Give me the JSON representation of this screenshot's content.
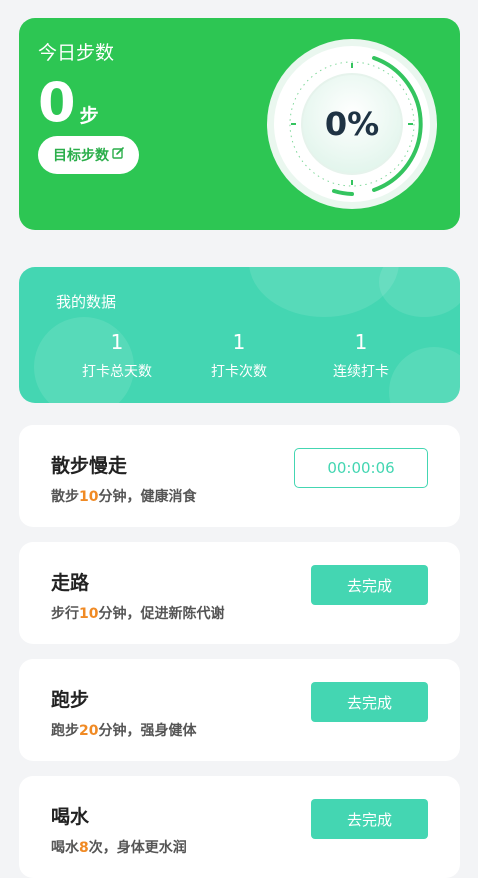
{
  "steps": {
    "title": "今日步数",
    "count": "0",
    "unit": "步",
    "goal_label": "目标步数",
    "percent": "0%",
    "percent_value": 0,
    "accent": "#2dc653"
  },
  "my_data": {
    "title": "我的数据",
    "stats": [
      {
        "value": "1",
        "label": "打卡总天数"
      },
      {
        "value": "1",
        "label": "打卡次数"
      },
      {
        "value": "1",
        "label": "连续打卡"
      }
    ],
    "color": "#44d6b2"
  },
  "tasks": [
    {
      "name": "散步慢走",
      "desc_prefix": "散步",
      "highlight": "10",
      "desc_suffix": "分钟，健康消食",
      "timer": "00:00:06"
    },
    {
      "name": "走路",
      "desc_prefix": "步行",
      "highlight": "10",
      "desc_suffix": "分钟，促进新陈代谢",
      "button": "去完成"
    },
    {
      "name": "跑步",
      "desc_prefix": "跑步",
      "highlight": "20",
      "desc_suffix": "分钟，强身健体",
      "button": "去完成"
    },
    {
      "name": "喝水",
      "desc_prefix": "喝水",
      "highlight": "8",
      "desc_suffix": "次，身体更水润",
      "button": "去完成"
    }
  ],
  "highlight_color": "#f08a24"
}
